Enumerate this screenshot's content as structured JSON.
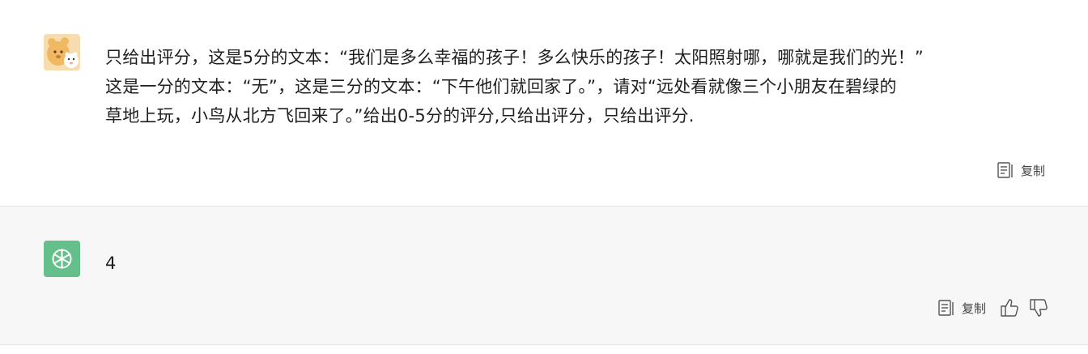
{
  "conversation": {
    "user_message": {
      "lines": [
        "只给出评分，这是5分的文本：“我们是多么幸福的孩子！多么快乐的孩子！太阳照射哪，哪就是我们的光！”",
        "这是一分的文本：“无”，这是三分的文本：“下午他们就回家了。”，请对“远处看就像三个小朋友在碧绿的",
        "草地上玩，小鸟从北方飞回来了。”给出0-5分的评分,只给出评分，只给出评分."
      ],
      "copy_label": "复制",
      "avatar_icon": "cartoon-bear-avatar"
    },
    "assistant_message": {
      "text": "4",
      "copy_label": "复制",
      "avatar_icon": "openai-logo-icon",
      "avatar_color": "#64c08b"
    }
  }
}
